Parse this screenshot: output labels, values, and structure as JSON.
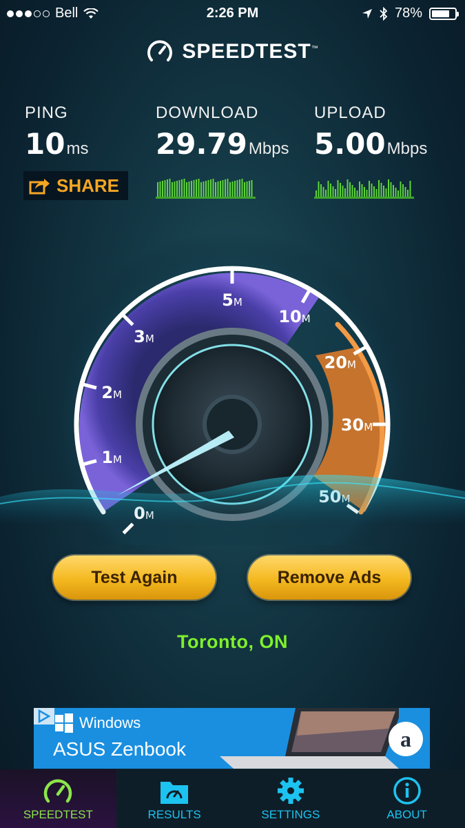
{
  "status_bar": {
    "carrier": "Bell",
    "time": "2:26 PM",
    "battery": "78%",
    "battery_level": 0.78,
    "signal_bars": 3
  },
  "header": {
    "app_name": "SPEEDTEST",
    "trademark": "™"
  },
  "results": {
    "ping": {
      "label": "PING",
      "value": "10",
      "unit": "ms"
    },
    "download": {
      "label": "DOWNLOAD",
      "value": "29.79",
      "unit": "Mbps"
    },
    "upload": {
      "label": "UPLOAD",
      "value": "5.00",
      "unit": "Mbps"
    }
  },
  "share_label": "SHARE",
  "gauge": {
    "ticks": [
      {
        "num": "0",
        "unit": "M"
      },
      {
        "num": "1",
        "unit": "M"
      },
      {
        "num": "2",
        "unit": "M"
      },
      {
        "num": "3",
        "unit": "M"
      },
      {
        "num": "5",
        "unit": "M"
      },
      {
        "num": "10",
        "unit": "M"
      },
      {
        "num": "20",
        "unit": "M"
      },
      {
        "num": "30",
        "unit": "M"
      },
      {
        "num": "50",
        "unit": "M"
      }
    ],
    "needle_value": "0"
  },
  "buttons": {
    "test_again": "Test Again",
    "remove_ads": "Remove Ads"
  },
  "location": "Toronto, ON",
  "ad": {
    "brand": "Windows",
    "product": "ASUS Zenbook",
    "vendor_logo": "a"
  },
  "tabs": [
    {
      "label": "SPEEDTEST",
      "icon": "speedometer-icon",
      "active": true
    },
    {
      "label": "RESULTS",
      "icon": "results-folder-icon",
      "active": false
    },
    {
      "label": "SETTINGS",
      "icon": "gear-icon",
      "active": false
    },
    {
      "label": "ABOUT",
      "icon": "info-icon",
      "active": false
    }
  ],
  "colors": {
    "accent_green": "#7ff02b",
    "tab_blue": "#1dc3f0",
    "button_gold": "#f4b81f",
    "share_orange": "#f5a623",
    "gauge_orange": "#e8852a"
  }
}
